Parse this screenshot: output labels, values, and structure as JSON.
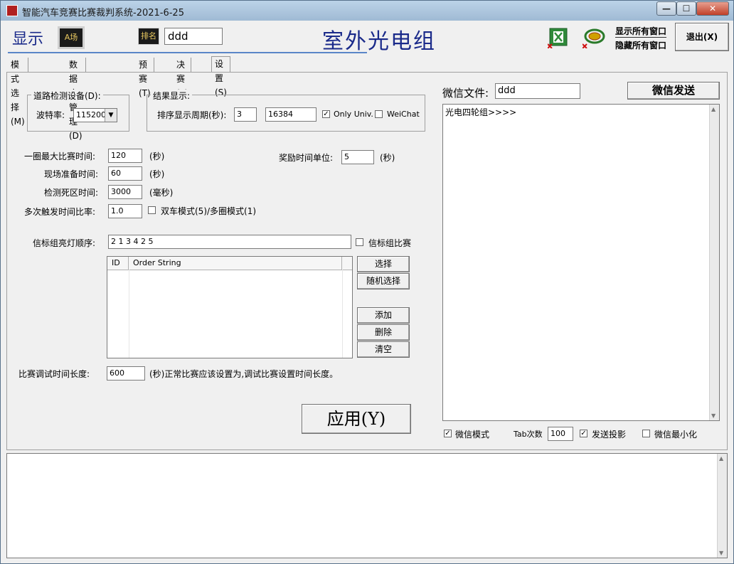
{
  "window": {
    "title": "智能汽车竞赛比赛裁判系统-2021-6-25",
    "minimize": "—",
    "maximize": "☐",
    "close": "✕"
  },
  "toolbar": {
    "display_label": "显示",
    "a_field_icon": "A场",
    "rank_icon": "排名",
    "rank_input_value": "ddd",
    "group_title": "室外光电组",
    "excel_icon": "excel-icon",
    "refresh_icon": "refresh-icon",
    "show_all_windows": "显示所有窗口",
    "hide_all_windows": "隐藏所有窗口",
    "exit_button": "退出(X)"
  },
  "tabs": [
    {
      "label": "模式选择(M)"
    },
    {
      "label": "数据库管理(D)"
    },
    {
      "label": "预赛(T)"
    },
    {
      "label": "决赛(F)"
    },
    {
      "label": "设置(S)"
    }
  ],
  "road_detection": {
    "group_label": "道路检测设备(D):",
    "baud_label": "波特率:",
    "baud_value": "115200"
  },
  "result_display": {
    "group_label": "结果显示:",
    "sort_period_label": "排序显示周期(秒):",
    "sort_period_value": "3",
    "second_value": "16384",
    "only_univ_label": "Only Univ.",
    "only_univ_checked": true,
    "wechat_label": "WeiChat",
    "wechat_checked": false
  },
  "timing": {
    "max_lap_label": "一圈最大比赛时间:",
    "max_lap_value": "120",
    "max_lap_unit": "(秒)",
    "prep_label": "现场准备时间:",
    "prep_value": "60",
    "prep_unit": "(秒)",
    "dead_zone_label": "检测死区时间:",
    "dead_zone_value": "3000",
    "dead_zone_unit": "(毫秒)",
    "multi_trigger_label": "多次触发时间比率:",
    "multi_trigger_value": "1.0",
    "dual_car_label": "双车模式(5)/多圈模式(1)",
    "dual_car_checked": false,
    "reward_unit_label": "奖励时间单位:",
    "reward_unit_value": "5",
    "reward_unit_unit": "(秒)"
  },
  "beacon": {
    "order_label": "信标组亮灯顺序:",
    "order_value": "2 1 3 4 2 5",
    "beacon_match_label": "信标组比赛",
    "beacon_match_checked": false,
    "columns": [
      "ID",
      "Order String"
    ],
    "select_button": "选择",
    "random_button": "随机选择",
    "add_button": "添加",
    "delete_button": "删除",
    "clear_button": "清空"
  },
  "debug": {
    "label": "比赛调试时间长度:",
    "value": "600",
    "hint": "(秒)正常比赛应该设置为,调试比赛设置时间长度。"
  },
  "apply_button": "应用(Y)",
  "wechat": {
    "file_label": "微信文件:",
    "file_value": "ddd",
    "send_button": "微信发送",
    "text_content": "光电四轮组>>>>",
    "mode_label": "微信模式",
    "mode_checked": true,
    "tab_count_label": "Tab次数",
    "tab_count_value": "100",
    "send_projection_label": "发送投影",
    "send_projection_checked": true,
    "minimize_label": "微信最小化",
    "minimize_checked": false
  }
}
